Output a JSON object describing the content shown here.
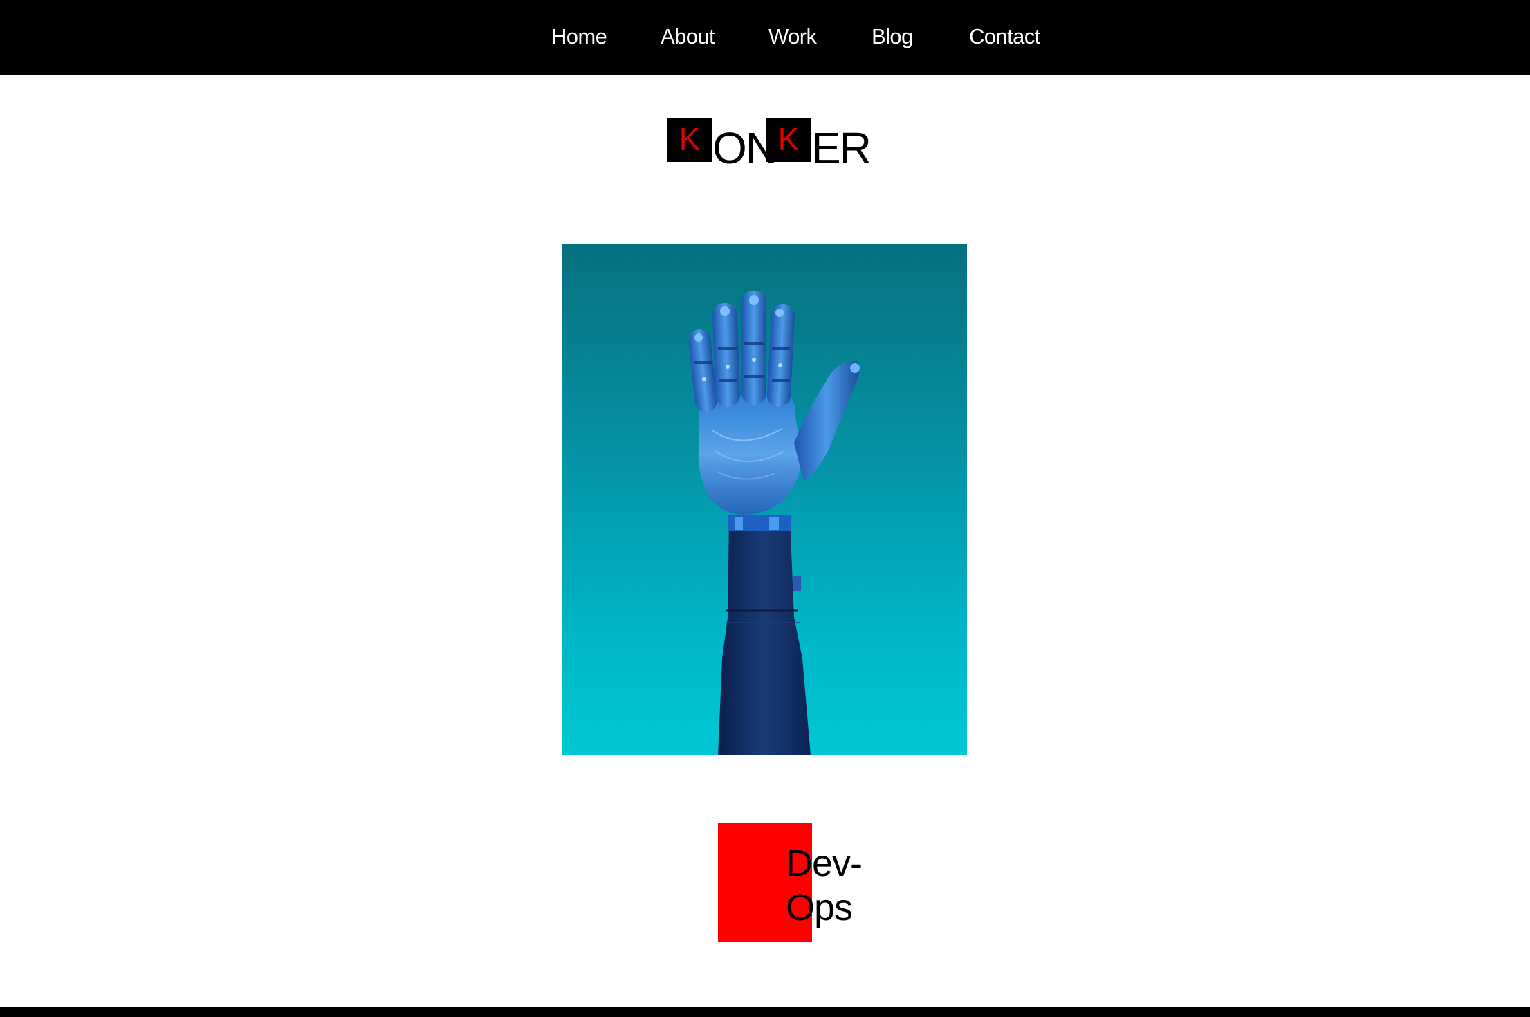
{
  "nav": {
    "items": [
      {
        "label": "Home"
      },
      {
        "label": "About"
      },
      {
        "label": "Work"
      },
      {
        "label": "Blog"
      },
      {
        "label": "Contact"
      }
    ]
  },
  "logo": {
    "box_letter_1": "K",
    "text_1": "ON",
    "box_letter_2": "K",
    "text_2": "ER"
  },
  "hero": {
    "image_subject": "robotic-hand",
    "background_top": "#06707f",
    "background_bottom": "#00c8d4"
  },
  "card": {
    "label": "Dev-\nOps",
    "accent_color": "#ff0000"
  },
  "colors": {
    "nav_background": "#000000",
    "nav_text": "#ffffff",
    "logo_accent": "#e00000",
    "footer": "#000000"
  }
}
